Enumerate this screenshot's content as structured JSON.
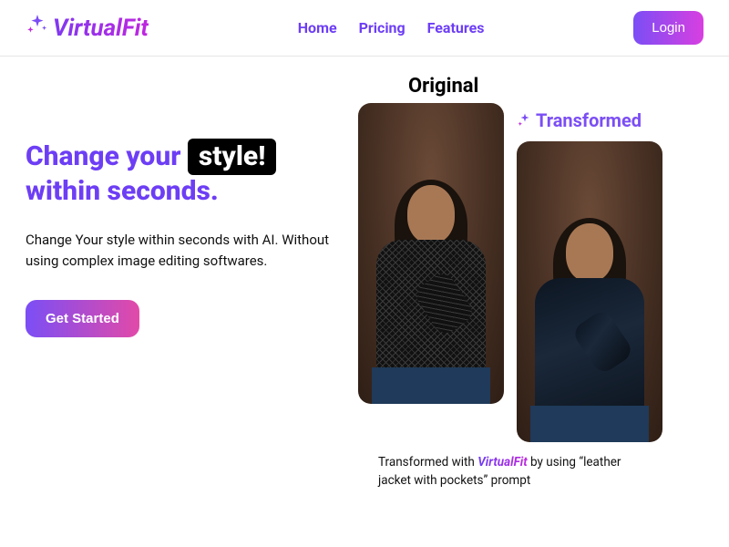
{
  "brand": "VirtualFit",
  "nav": {
    "items": [
      "Home",
      "Pricing",
      "Features"
    ],
    "login": "Login"
  },
  "hero": {
    "line1_a": "Change your ",
    "line1_highlight": "style!",
    "line2": "within seconds.",
    "sub": "Change Your style within seconds with AI. Without using complex image editing softwares.",
    "cta": "Get Started"
  },
  "showcase": {
    "original": "Original",
    "transformed": "Transformed",
    "caption_a": "Transformed with ",
    "caption_brand": "VirtualFit",
    "caption_b": " by using “leather jacket with pockets” prompt"
  }
}
